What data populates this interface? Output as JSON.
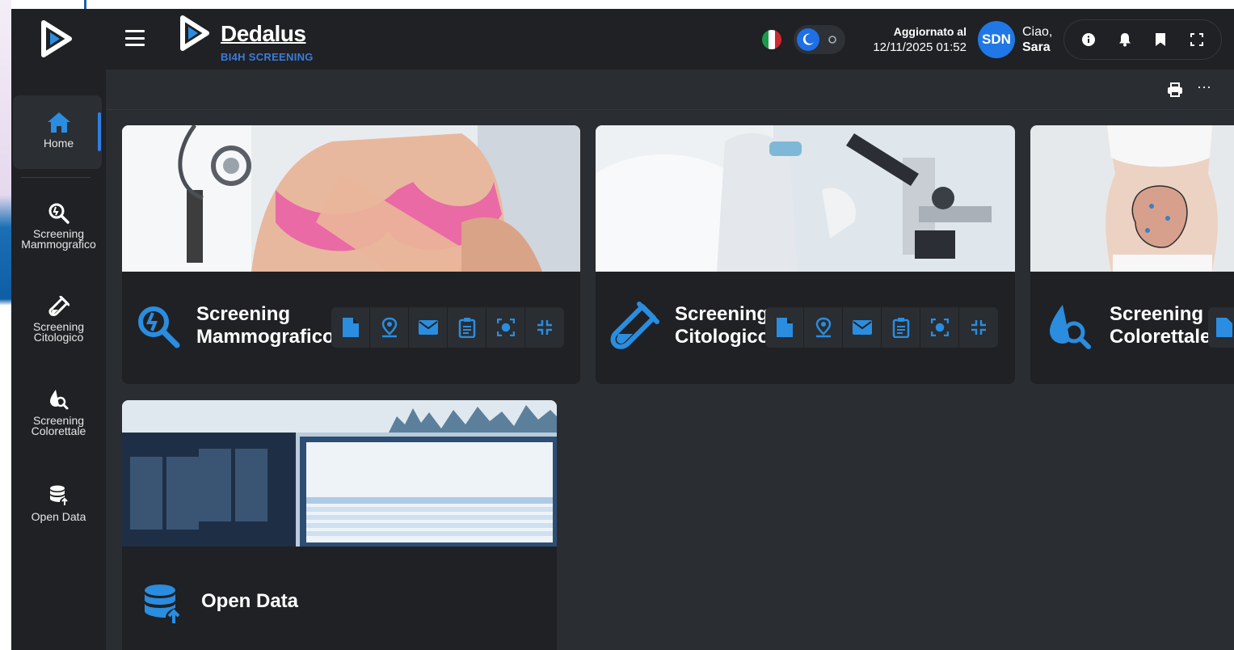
{
  "app": {
    "brand_name": "Dedalus",
    "brand_subtitle": "BI4H SCREENING",
    "updated_label": "Aggiornato al",
    "updated_value": "12/11/2025 01:52",
    "avatar_initials": "SDN",
    "greeting": "Ciao,",
    "user_name": "Sara",
    "accent_color": "#1f78e6"
  },
  "subbar": {
    "more_label": "···"
  },
  "sidebar": {
    "items": [
      {
        "label": "Home",
        "icon": "home-icon"
      },
      {
        "label": "Screening Mammografico",
        "icon": "mammography-search-icon"
      },
      {
        "label": "Screening Citologico",
        "icon": "test-tube-icon"
      },
      {
        "label": "Screening Colorettale",
        "icon": "drop-search-icon"
      },
      {
        "label": "Open Data",
        "icon": "database-upload-icon"
      }
    ]
  },
  "cards": [
    {
      "title_line1": "Screening",
      "title_line2": "Mammografico",
      "icon": "mammography-search-icon"
    },
    {
      "title_line1": "Screening",
      "title_line2": "Citologico",
      "icon": "test-tube-icon"
    },
    {
      "title_line1": "Screening",
      "title_line2": "Colorettale",
      "icon": "drop-search-icon"
    },
    {
      "title_line1": "Open Data",
      "title_line2": "",
      "icon": "database-upload-icon"
    }
  ],
  "card_actions": [
    "document-icon",
    "location-person-icon",
    "mail-icon",
    "clipboard-icon",
    "focus-icon",
    "collapse-icon"
  ]
}
